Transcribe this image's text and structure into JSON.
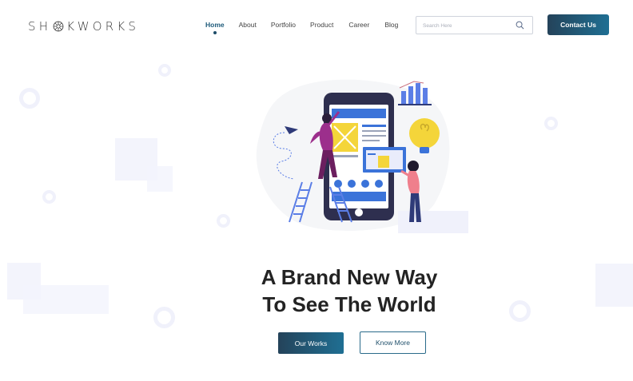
{
  "header": {
    "logo": {
      "left": "SH",
      "right": "KWORKS"
    },
    "nav": [
      {
        "label": "Home",
        "active": true
      },
      {
        "label": "About",
        "active": false
      },
      {
        "label": "Portfolio",
        "active": false
      },
      {
        "label": "Product",
        "active": false
      },
      {
        "label": "Career",
        "active": false
      },
      {
        "label": "Blog",
        "active": false
      }
    ],
    "search": {
      "placeholder": "Search Here",
      "icon": "search-icon"
    },
    "contact_label": "Contact Us"
  },
  "hero": {
    "headline_line1": "A Brand New Way",
    "headline_line2": "To See The World",
    "primary_button": "Our Works",
    "secondary_button": "Know More"
  },
  "colors": {
    "brand_dark": "#24435a",
    "brand_accent": "#1f6f93",
    "illustration_blue": "#3b73d9",
    "illustration_yellow": "#f4d53a",
    "illustration_purple": "#9c2f8c"
  }
}
